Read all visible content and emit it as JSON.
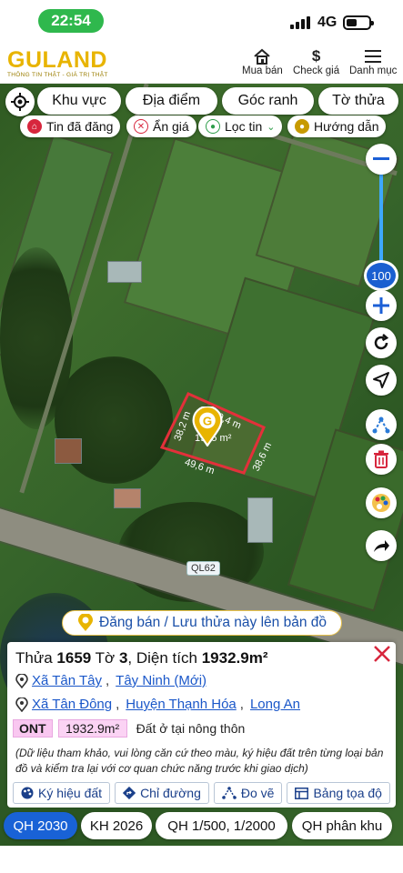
{
  "status_bar": {
    "time": "22:54",
    "network": "4G"
  },
  "header": {
    "logo": "GULAND",
    "tagline": "THÔNG TIN THẬT - GIÁ TRỊ THẬT",
    "nav": [
      {
        "label": "Mua bán",
        "icon": "house-icon"
      },
      {
        "label": "Check giá",
        "icon": "dollar-icon"
      },
      {
        "label": "Danh mục",
        "icon": "menu-icon"
      }
    ]
  },
  "filters": {
    "chips": [
      "Khu vực",
      "Địa điểm",
      "Góc ranh",
      "Tờ thửa"
    ],
    "options": [
      {
        "label": "Tin đã đăng",
        "icon": "post-icon",
        "color": "#d7263d"
      },
      {
        "label": "Ẩn giá",
        "icon": "hide-price-icon",
        "color": "#d7263d"
      },
      {
        "label": "Lọc tin",
        "icon": "filter-icon",
        "color": "#2e9d4a"
      },
      {
        "label": "Hướng dẫn",
        "icon": "guide-icon",
        "color": "#c79a00"
      }
    ]
  },
  "map": {
    "zoom_level": "100",
    "parcel_area": "1945 m²",
    "edge_labels": [
      "50,4 m",
      "38,2 m",
      "49,6 m",
      "38,6 m"
    ],
    "road_label": "QL62",
    "colors": {
      "parcel_border": "#e3303a",
      "accent": "#e8b400"
    }
  },
  "post_banner": {
    "text": "Đăng bán / Lưu thửa này lên bản đồ"
  },
  "parcel_info": {
    "title_prefix": "Thửa",
    "parcel_no": "1659",
    "sheet_prefix": "Tờ",
    "sheet_no": "3",
    "area_prefix": ", Diện tích",
    "area": "1932.9m²",
    "address_new": {
      "ward": "Xã Tân Tây",
      "province": "Tây Ninh (Mới)"
    },
    "address_old": {
      "ward": "Xã Tân Đông",
      "district": "Huyện Thạnh Hóa",
      "province": "Long An"
    },
    "land_code": "ONT",
    "land_area": "1932.9m²",
    "land_desc": "Đất ở tại nông thôn",
    "note": "(Dữ liệu tham khảo, vui lòng căn cứ theo màu, ký hiệu đất trên từng loại bản đồ và kiểm tra lại với cơ quan chức năng trước khi giao dịch)",
    "actions": [
      "Ký hiệu đất",
      "Chỉ đường",
      "Đo vẽ",
      "Bảng tọa độ"
    ]
  },
  "plan_tabs": [
    "QH 2030",
    "KH 2026",
    "QH 1/500, 1/2000",
    "QH phân khu"
  ],
  "active_plan_tab": "QH 2030"
}
